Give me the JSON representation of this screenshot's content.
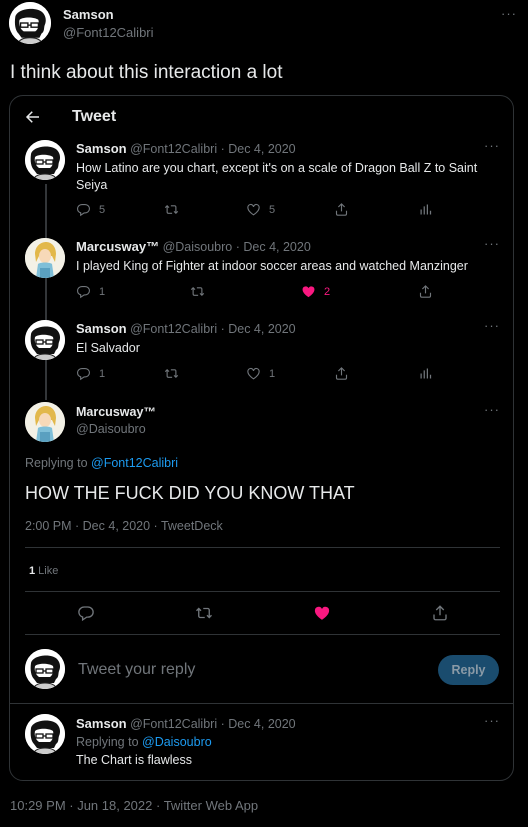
{
  "outer": {
    "author_name": "Samson",
    "author_handle": "@Font12Calibri",
    "tweet_text": "I think about this interaction a lot",
    "footer_meta": "10:29 PM · Jun 18, 2022 · Twitter Web App"
  },
  "embed": {
    "header_title": "Tweet",
    "thread": [
      {
        "name": "Samson",
        "handle": "@Font12Calibri",
        "date": "· Dec 4, 2020",
        "text": "How Latino are you chart, except it's on a scale of Dragon Ball Z to Saint Seiya",
        "replies": "5",
        "retweets": "",
        "likes": "5",
        "liked": false
      },
      {
        "name": "Marcusway™",
        "handle": "@Daisoubro",
        "date": "· Dec 4, 2020",
        "text": "I played King of Fighter at indoor soccer areas and watched Manzinger",
        "replies": "1",
        "retweets": "",
        "likes": "2",
        "liked": true
      },
      {
        "name": "Samson",
        "handle": "@Font12Calibri",
        "date": "· Dec 4, 2020",
        "text": "El Salvador",
        "replies": "1",
        "retweets": "",
        "likes": "1",
        "liked": false
      }
    ],
    "focused": {
      "name": "Marcusway™",
      "handle": "@Daisoubro",
      "replying_prefix": "Replying to ",
      "replying_to": "@Font12Calibri",
      "text": "HOW THE FUCK DID YOU KNOW THAT",
      "meta": "2:00 PM · Dec 4, 2020 · TweetDeck",
      "like_count": "1",
      "like_label": " Like"
    },
    "reply_box": {
      "placeholder": "Tweet your reply",
      "button": "Reply"
    },
    "bottom_reply": {
      "name": "Samson",
      "handle": "@Font12Calibri",
      "date": "· Dec 4, 2020",
      "replying_prefix": "Replying to ",
      "replying_to": "@Daisoubro",
      "text": "The Chart is flawless"
    }
  },
  "colors": {
    "background": "#000000",
    "accent": "#1d9bf0",
    "like": "#f91880",
    "muted": "#71767b",
    "reply_button": "#1a4c6e"
  }
}
